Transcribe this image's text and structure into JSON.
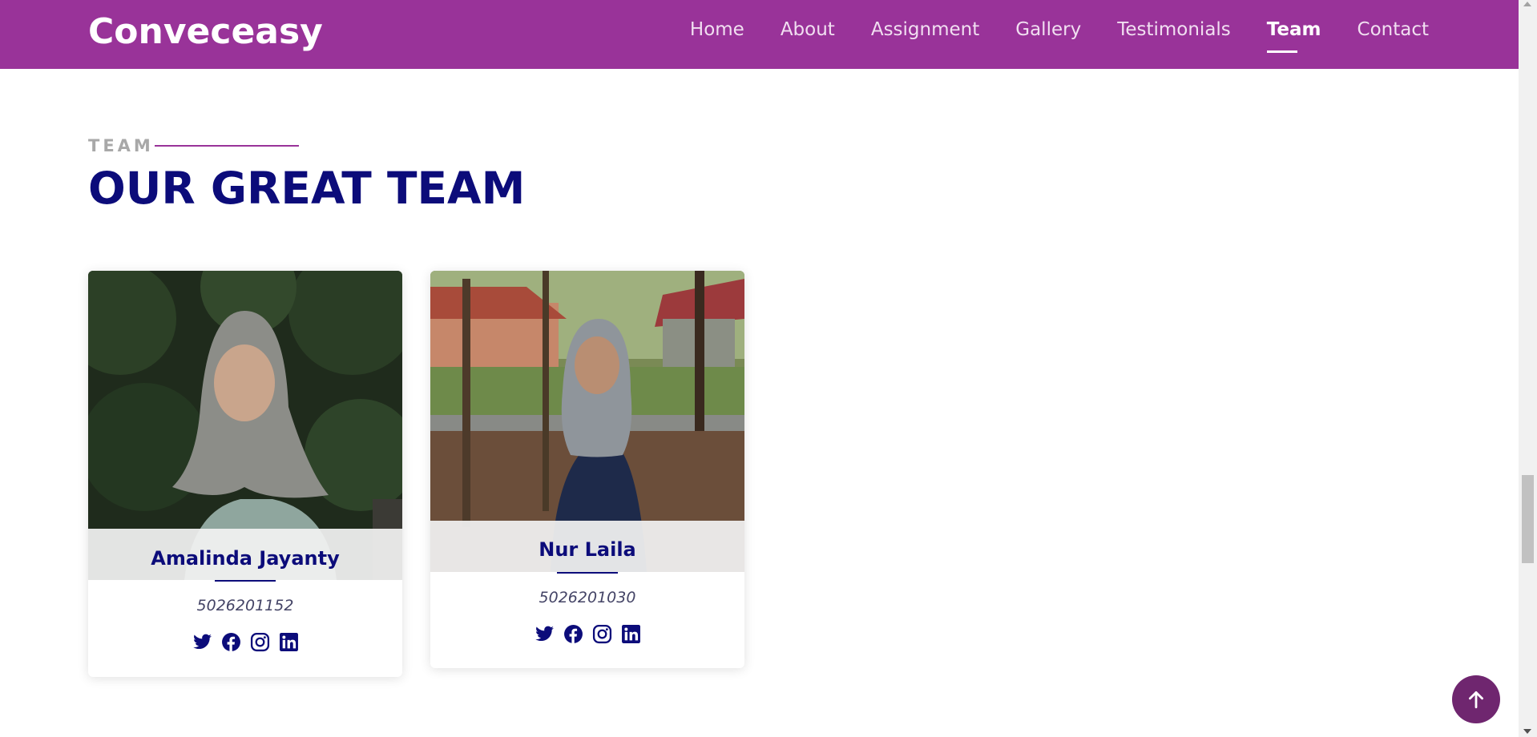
{
  "brand": {
    "name": "Conveceasy"
  },
  "nav": {
    "items": [
      {
        "label": "Home"
      },
      {
        "label": "About"
      },
      {
        "label": "Assignment"
      },
      {
        "label": "Gallery"
      },
      {
        "label": "Testimonials"
      },
      {
        "label": "Team",
        "active": true
      },
      {
        "label": "Contact"
      }
    ]
  },
  "section": {
    "label": "TEAM",
    "title": "OUR GREAT TEAM"
  },
  "team": [
    {
      "name": "Amalinda Jayanty",
      "id": "5026201152",
      "social": [
        "twitter-icon",
        "facebook-icon",
        "instagram-icon",
        "linkedin-icon"
      ]
    },
    {
      "name": "Nur Laila",
      "id": "5026201030",
      "social": [
        "twitter-icon",
        "facebook-icon",
        "instagram-icon",
        "linkedin-icon"
      ]
    }
  ],
  "colors": {
    "header": "#993399",
    "accent": "#0c0c7a",
    "back_to_top": "#6f266f"
  }
}
